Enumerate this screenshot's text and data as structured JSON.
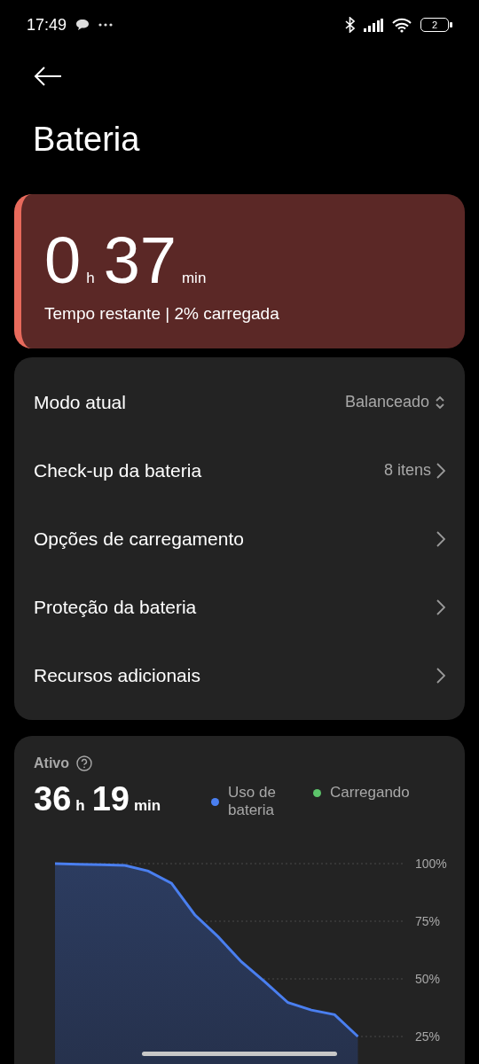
{
  "status_bar": {
    "time": "17:49",
    "battery": "2"
  },
  "title": "Bateria",
  "remaining": {
    "hours": "0",
    "hours_unit": "h",
    "minutes": "37",
    "minutes_unit": "min",
    "caption": "Tempo restante | 2% carregada"
  },
  "settings": [
    {
      "label": "Modo atual",
      "value": "Balanceado",
      "kind": "dropdown"
    },
    {
      "label": "Check-up da bateria",
      "value": "8 itens",
      "kind": "link"
    },
    {
      "label": "Opções de carregamento",
      "kind": "link"
    },
    {
      "label": "Proteção da bateria",
      "kind": "link"
    },
    {
      "label": "Recursos adicionais",
      "kind": "link"
    }
  ],
  "usage": {
    "heading": "Ativo",
    "hours": "36",
    "hours_unit": "h",
    "minutes": "19",
    "minutes_unit": "min",
    "charging_legend": {
      "label": "Carregando",
      "color": "#5cc46a"
    },
    "chart_data": {
      "type": "area",
      "grid": true,
      "ylim": [
        25,
        100
      ],
      "yticks": [
        {
          "value": 100,
          "label": "100%"
        },
        {
          "value": 75,
          "label": "75%"
        },
        {
          "value": 50,
          "label": "50%"
        },
        {
          "value": 25,
          "label": "25%"
        }
      ],
      "categories": [
        null,
        null,
        null,
        null,
        null,
        null,
        null,
        null,
        null,
        null,
        null,
        null,
        null,
        null,
        null,
        null
      ],
      "series": [
        {
          "name": "Uso de bateria",
          "color": "#4a7ff0",
          "values": [
            100,
            99.7,
            99.5,
            99.2,
            96.8,
            91.5,
            77.8,
            68.3,
            57.4,
            48.8,
            39.7,
            36.5,
            34.5,
            25,
            null,
            null
          ]
        }
      ]
    }
  }
}
